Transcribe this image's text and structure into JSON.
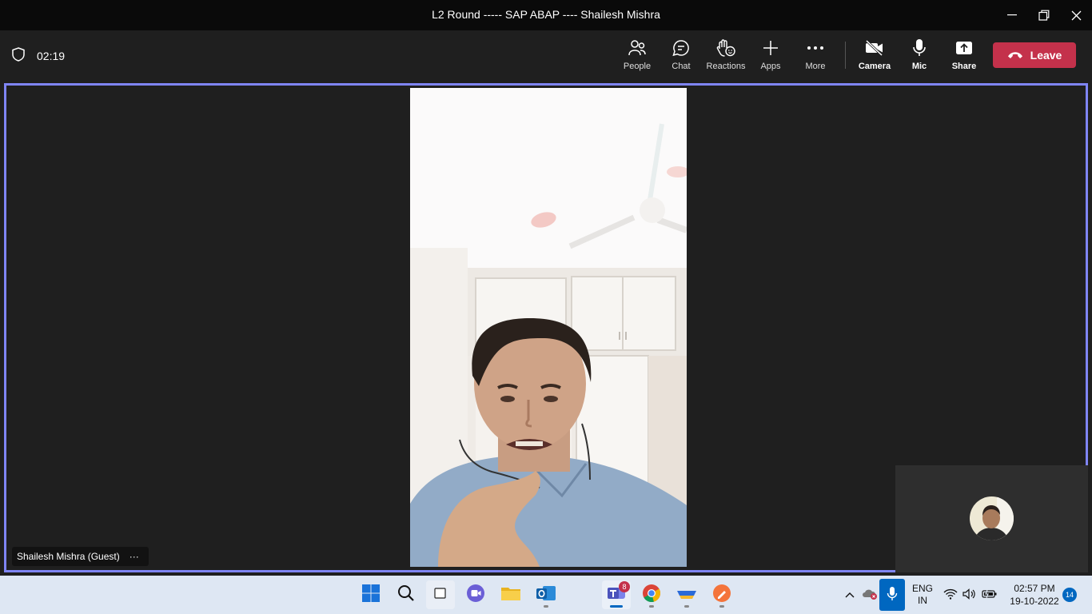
{
  "window": {
    "title": "L2 Round ----- SAP ABAP ---- Shailesh Mishra"
  },
  "toolbar": {
    "timer": "02:19",
    "people": "People",
    "chat": "Chat",
    "reactions": "Reactions",
    "apps": "Apps",
    "more": "More",
    "camera": "Camera",
    "mic": "Mic",
    "share": "Share",
    "leave": "Leave"
  },
  "participant": {
    "name": "Shailesh Mishra (Guest)",
    "more": "···"
  },
  "taskbar": {
    "teams_badge": "8",
    "lang_top": "ENG",
    "lang_bottom": "IN",
    "time": "02:57 PM",
    "date": "19-10-2022",
    "notifications": "14"
  },
  "colors": {
    "accent": "#7f85f5",
    "leave": "#c4314b",
    "taskbar": "#dee7f3"
  }
}
